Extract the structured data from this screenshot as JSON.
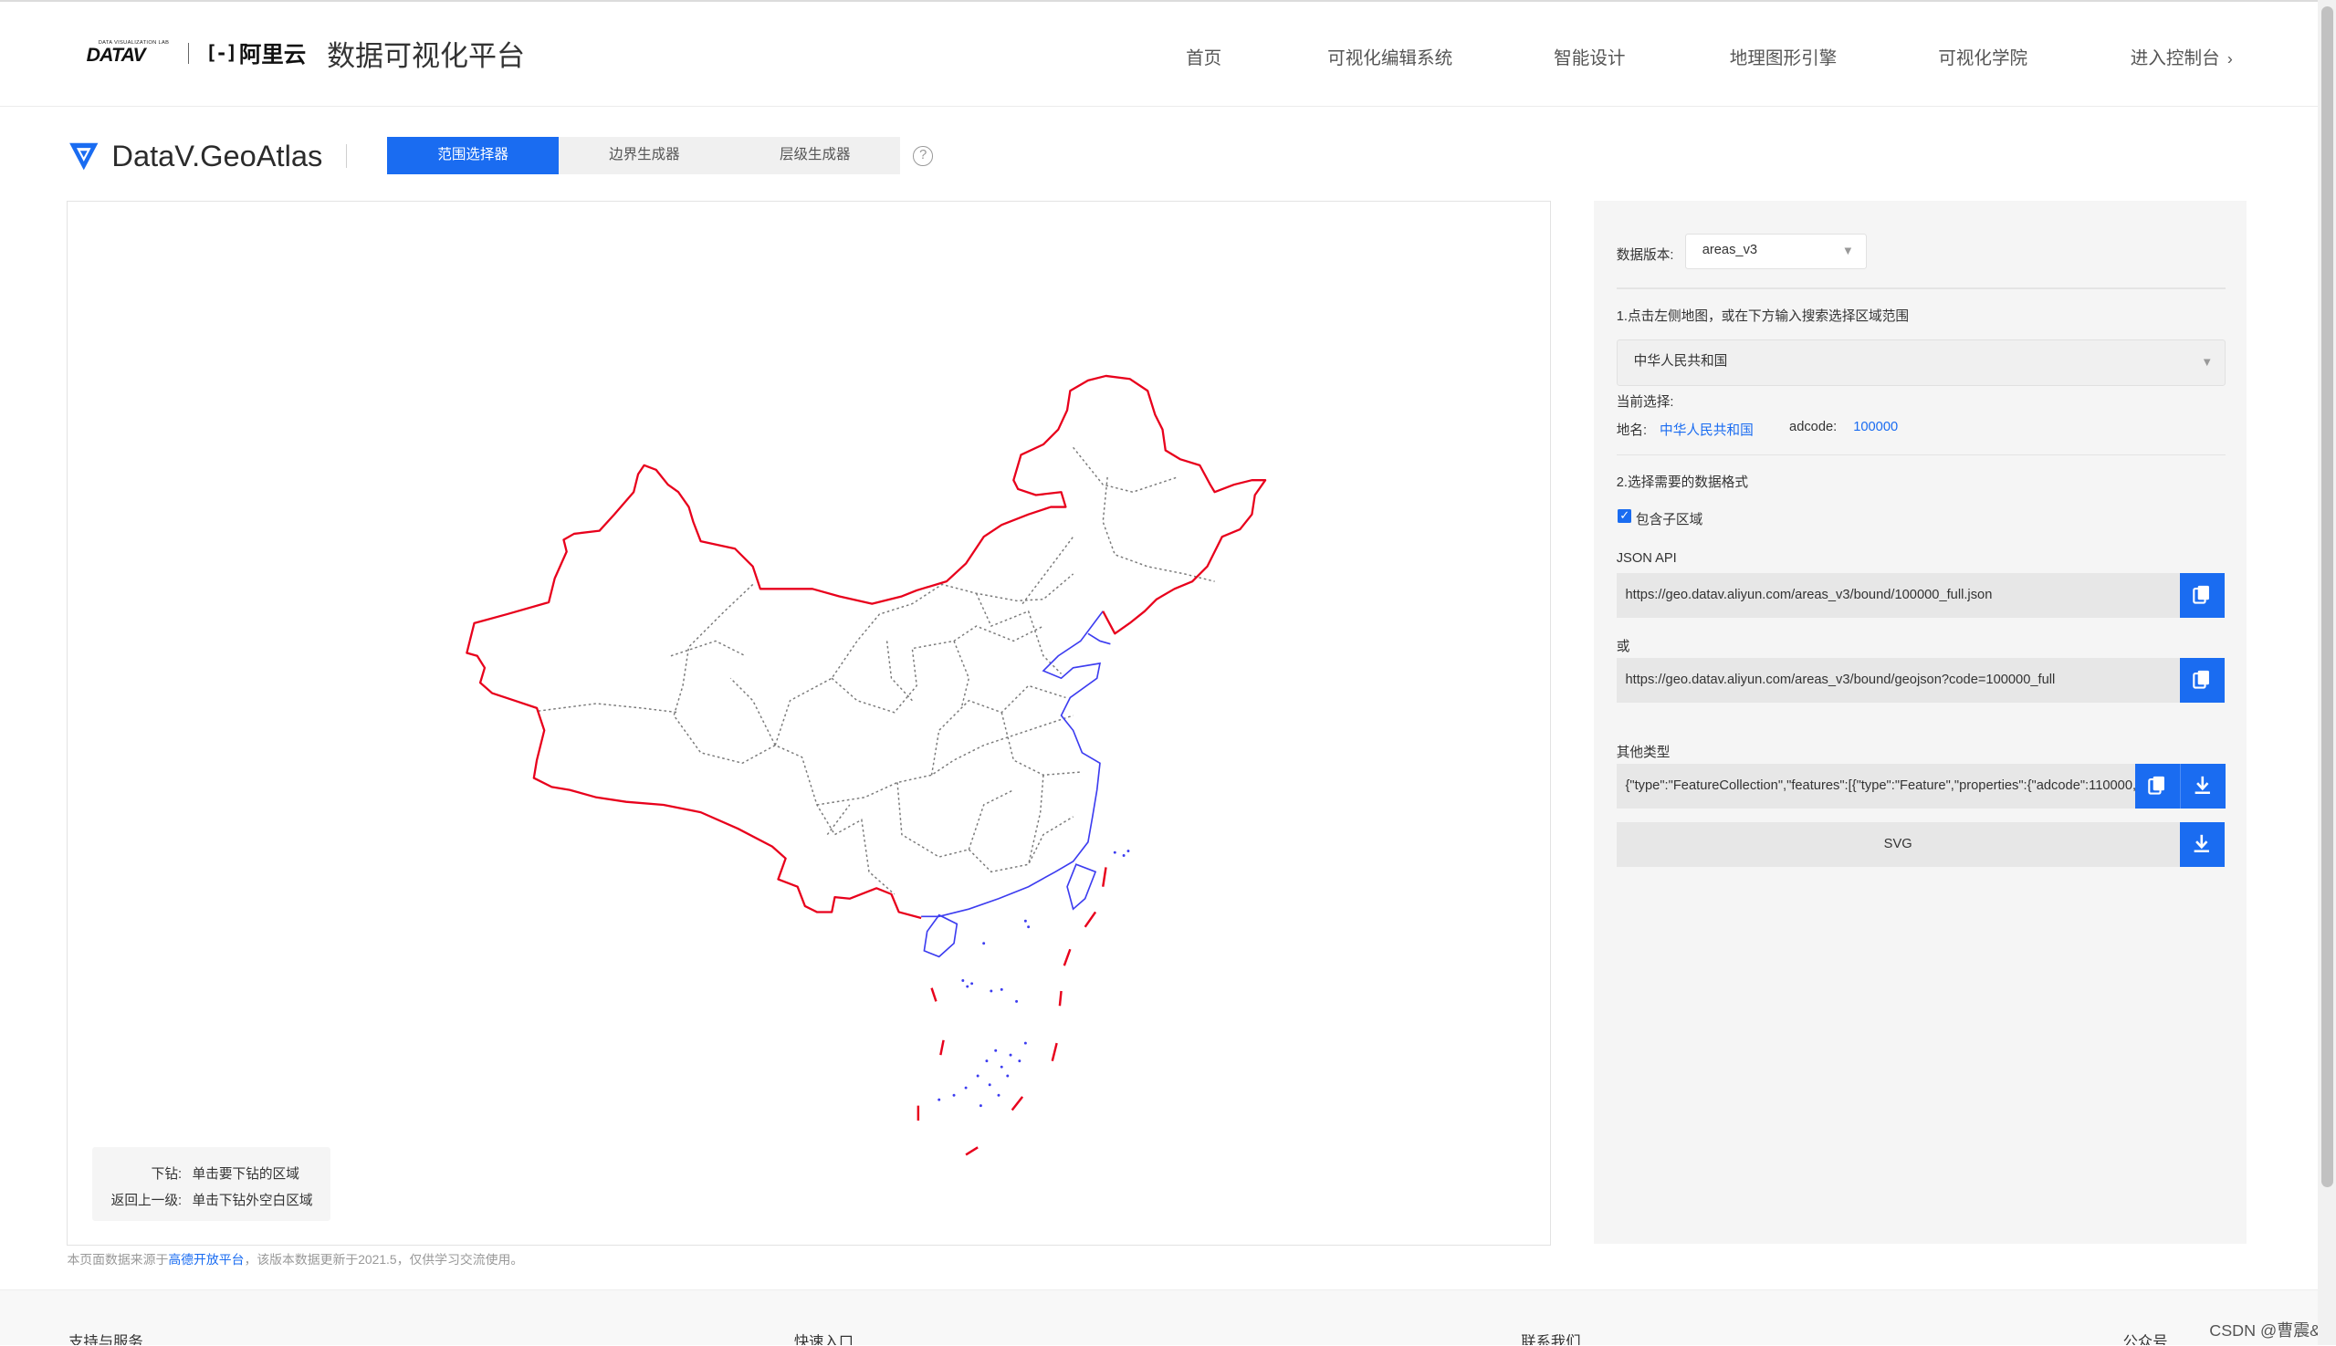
{
  "topnav": {
    "brand_tiny": "DATA VISUALIZATION LAB",
    "brand_mark": "DATAV",
    "aliyun_bracket": "[-]",
    "aliyun_text": "阿里云",
    "platform_title": "数据可视化平台",
    "items": [
      "首页",
      "可视化编辑系统",
      "智能设计",
      "地理图形引擎",
      "可视化学院"
    ],
    "console_label": "进入控制台",
    "console_chevron": "›"
  },
  "header": {
    "title": "DataV.GeoAtlas",
    "tabs": [
      {
        "label": "范围选择器",
        "active": true
      },
      {
        "label": "边界生成器",
        "active": false
      },
      {
        "label": "层级生成器",
        "active": false
      }
    ],
    "help_glyph": "?"
  },
  "map": {
    "tips": [
      {
        "key": "下钻:",
        "value": "单击要下钻的区域"
      },
      {
        "key": "返回上一级:",
        "value": "单击下钻外空白区域"
      }
    ],
    "colors": {
      "border": "#e8001c",
      "coast": "#3c3cf0",
      "inner": "#7a7a7a"
    }
  },
  "footnote": {
    "prefix": "本页面数据来源于",
    "link": "高德开放平台",
    "suffix": "，该版本数据更新于2021.5，仅供学习交流使用。"
  },
  "panel": {
    "version_label": "数据版本:",
    "version_value": "areas_v3",
    "step1": "1.点击左侧地图，或在下方输入搜索选择区域范围",
    "search_value": "中华人民共和国",
    "current_label": "当前选择:",
    "place_label": "地名:",
    "place_value": "中华人民共和国",
    "adcode_label": "adcode:",
    "adcode_value": "100000",
    "step2": "2.选择需要的数据格式",
    "include_sub": "包含子区域",
    "include_checked": true,
    "json_api_label": "JSON API",
    "url1": "https://geo.datav.aliyun.com/areas_v3/bound/100000_full.json",
    "or_label": "或",
    "url2": "https://geo.datav.aliyun.com/areas_v3/bound/geojson?code=100000_full",
    "other_label": "其他类型",
    "geojson_preview": "{\"type\":\"FeatureCollection\",\"features\":[{\"type\":\"Feature\",\"properties\":{\"adcode\":110000,\"name\":\"北京市\"",
    "svg_label": "SVG",
    "accent": "#1a6cf1"
  },
  "footer": {
    "cols": [
      "支持与服务",
      "快速入口",
      "联系我们",
      "公众号"
    ],
    "watermark": "CSDN @曹震&"
  }
}
